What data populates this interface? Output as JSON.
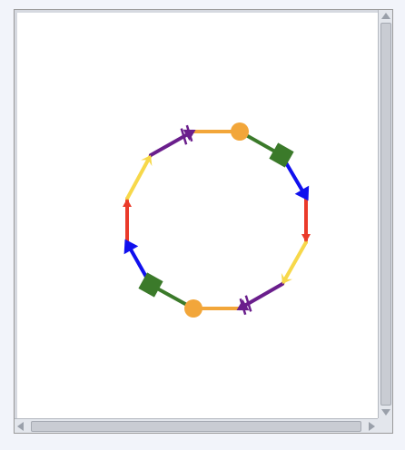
{
  "diagram": {
    "edges": [
      {
        "color": "#f2a63a",
        "end_marker": "circle"
      },
      {
        "color": "#3b7a2a",
        "end_marker": "square"
      },
      {
        "color": "#1010ee",
        "end_marker": "triangle"
      },
      {
        "color": "#ea3a2a",
        "end_marker": "arrow"
      },
      {
        "color": "#f7d84a",
        "end_marker": "chevron"
      },
      {
        "color": "#6a1e8c",
        "end_marker": "cross-arrow"
      },
      {
        "color": "#f2a63a",
        "end_marker": "circle"
      },
      {
        "color": "#3b7a2a",
        "end_marker": "square"
      },
      {
        "color": "#1010ee",
        "end_marker": "triangle"
      },
      {
        "color": "#ea3a2a",
        "end_marker": "arrow"
      },
      {
        "color": "#f7d84a",
        "end_marker": "chevron"
      },
      {
        "color": "#6a1e8c",
        "end_marker": "cross-arrow"
      }
    ]
  },
  "scrollbars": {
    "vertical": true,
    "horizontal": true
  }
}
